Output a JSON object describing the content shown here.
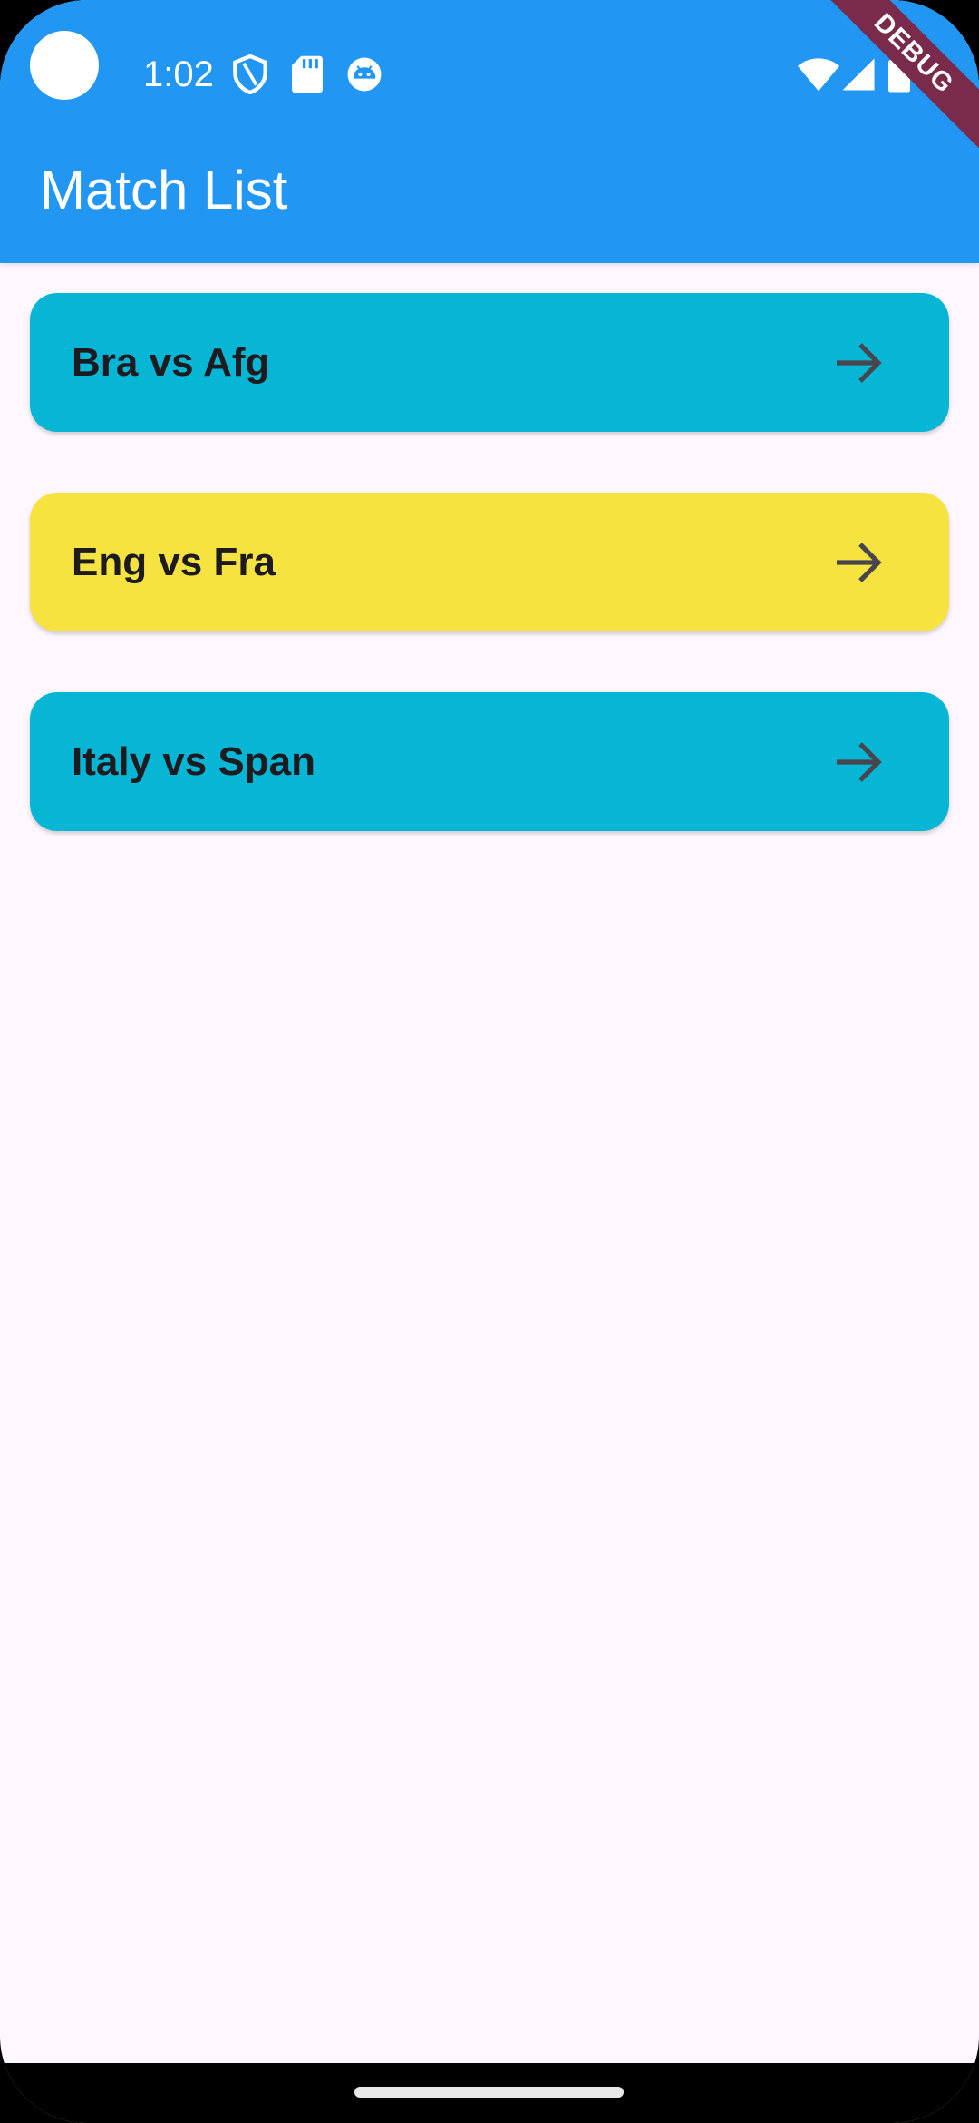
{
  "status_bar": {
    "time": "1:02",
    "icons": [
      "shield-icon",
      "sd-card-icon",
      "android-debug-icon",
      "wifi-icon",
      "cell-signal-icon",
      "battery-icon"
    ]
  },
  "debug_banner": {
    "label": "DEBUG"
  },
  "app_bar": {
    "title": "Match List",
    "color": "#2196F3"
  },
  "matches": [
    {
      "label": "Bra vs Afg",
      "color": "#06B6D4",
      "icon": "arrow-right-icon"
    },
    {
      "label": "Eng vs Fra",
      "color": "#F6E33F",
      "icon": "arrow-right-icon"
    },
    {
      "label": "Italy vs Span",
      "color": "#06B6D4",
      "icon": "arrow-right-icon"
    }
  ],
  "colors": {
    "background": "#FEF7FF",
    "text": "#1D1B20",
    "arrow": "#49454F"
  }
}
